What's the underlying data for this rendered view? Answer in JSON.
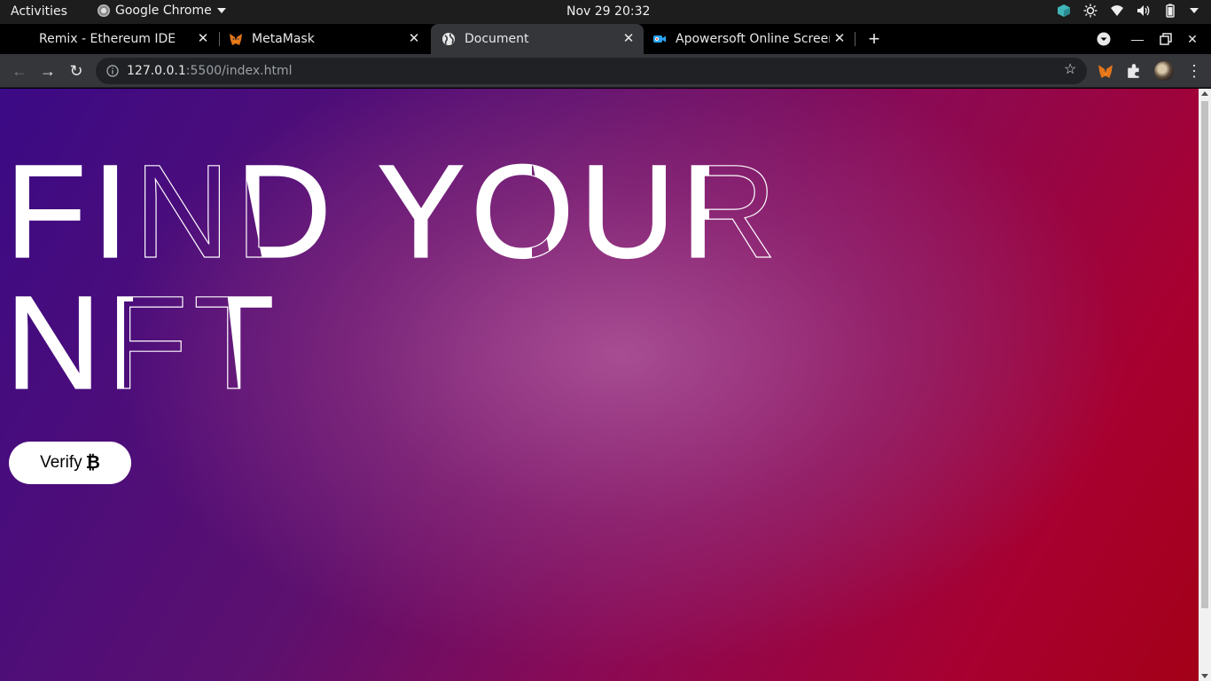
{
  "topbar": {
    "activities": "Activities",
    "app_name": "Google Chrome",
    "clock": "Nov 29  20:32"
  },
  "tabs": [
    {
      "title": "Remix - Ethereum IDE",
      "icon": "remix-icon",
      "active": false
    },
    {
      "title": "MetaMask",
      "icon": "metamask-fox-icon",
      "active": false
    },
    {
      "title": "Document",
      "icon": "globe-icon",
      "active": true
    },
    {
      "title": "Apowersoft Online Screen",
      "icon": "apowersoft-camera-icon",
      "active": false
    }
  ],
  "omnibox": {
    "host": "127.0.0.1",
    "rest": ":5500/index.html"
  },
  "page": {
    "headline_line1": "FIND YOUR",
    "headline_line2": "NFT",
    "verify_label": "Verify",
    "verify_symbol": "₿"
  },
  "colors": {
    "gradient_start": "#3b0a85",
    "gradient_mid": "#8a0a55",
    "gradient_end": "#a30018",
    "glow": "#aa5096",
    "button_bg": "#ffffff"
  }
}
